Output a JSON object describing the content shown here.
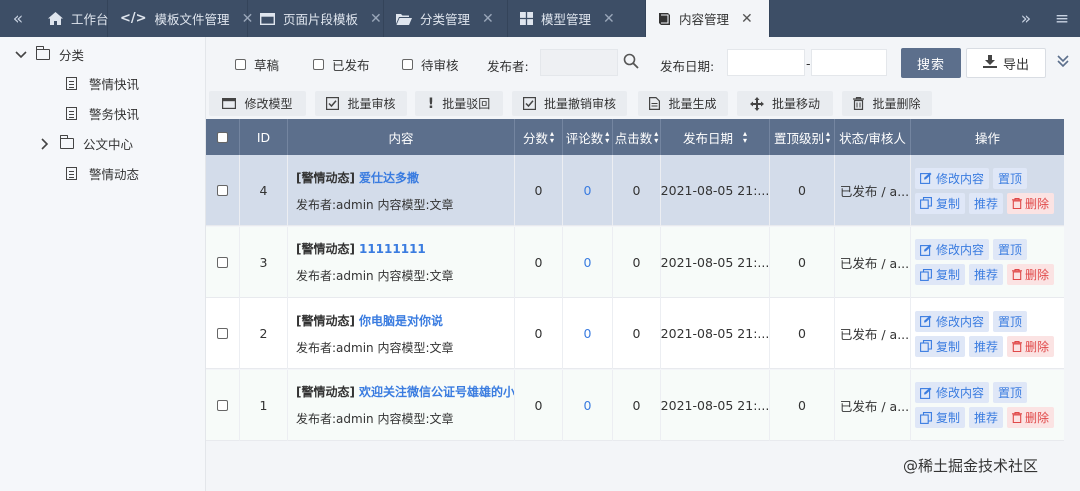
{
  "topbar": {
    "tabs": [
      {
        "label": "工作台",
        "icon": "home-icon",
        "closable": false
      },
      {
        "label": "模板文件管理",
        "icon": "code-icon",
        "closable": true
      },
      {
        "label": "页面片段模板",
        "icon": "window-icon",
        "closable": true
      },
      {
        "label": "分类管理",
        "icon": "folder-open-icon",
        "closable": true
      },
      {
        "label": "模型管理",
        "icon": "grid-icon",
        "closable": true
      },
      {
        "label": "内容管理",
        "icon": "book-icon",
        "closable": true,
        "active": true
      }
    ],
    "close_glyph": "✕",
    "left_arrow": "«",
    "right_arrow": "»",
    "menu_glyph": "≡"
  },
  "sidebar": {
    "root": "分类",
    "items": [
      "警情快讯",
      "警务快讯",
      "公文中心",
      "警情动态"
    ]
  },
  "filter": {
    "checks": [
      "草稿",
      "已发布",
      "待审核"
    ],
    "publisher_label": "发布者:",
    "date_label": "发布日期:",
    "date_sep": "-",
    "search": "搜索",
    "export": "导出"
  },
  "actions": [
    "修改模型",
    "批量审核",
    "批量驳回",
    "批量撤销审核",
    "批量生成",
    "批量移动",
    "批量删除"
  ],
  "table": {
    "headers": [
      "ID",
      "内容",
      "分数",
      "评论数",
      "点击数",
      "发布日期",
      "置顶级别",
      "状态/审核人",
      "操作"
    ],
    "rows": [
      {
        "id": "4",
        "category": "[警情动态]",
        "title": "爱仕达多撒",
        "meta": "发布者:admin 内容模型:文章",
        "score": "0",
        "comments": "0",
        "clicks": "0",
        "date": "2021-08-05 21:...",
        "top": "0",
        "status": "已发布 / a..."
      },
      {
        "id": "3",
        "category": "[警情动态]",
        "title": "11111111",
        "meta": "发布者:admin 内容模型:文章",
        "score": "0",
        "comments": "0",
        "clicks": "0",
        "date": "2021-08-05 21:...",
        "top": "0",
        "status": "已发布 / a..."
      },
      {
        "id": "2",
        "category": "[警情动态]",
        "title": "你电脑是对你说",
        "meta": "发布者:admin 内容模型:文章",
        "score": "0",
        "comments": "0",
        "clicks": "0",
        "date": "2021-08-05 21:...",
        "top": "0",
        "status": "已发布 / a..."
      },
      {
        "id": "1",
        "category": "[警情动态]",
        "title": "欢迎关注微信公证号雄雄的小",
        "meta": "发布者:admin 内容模型:文章",
        "score": "0",
        "comments": "0",
        "clicks": "0",
        "date": "2021-08-05 21:...",
        "top": "0",
        "status": "已发布 / a..."
      }
    ],
    "ops": {
      "edit": "修改内容",
      "top": "置顶",
      "copy": "复制",
      "recommend": "推荐",
      "delete": "删除"
    }
  },
  "watermark": "@稀土掘金技术社区",
  "colors": {
    "topbar": "#3d4e66",
    "header": "#5c6f8c",
    "link": "#3a7ce0",
    "selected_row": "#d3dcea",
    "danger": "#e04848"
  }
}
